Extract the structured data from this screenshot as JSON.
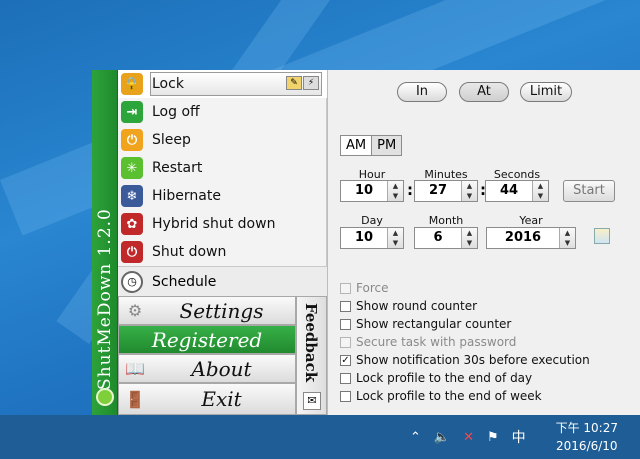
{
  "app": {
    "title": "ShutMeDown 1.2.0",
    "menu": [
      {
        "label": "Lock",
        "icon": "lock-icon",
        "color": "#e8a21b"
      },
      {
        "label": "Log off",
        "icon": "logoff-icon",
        "color": "#2ca53a"
      },
      {
        "label": "Sleep",
        "icon": "sleep-icon",
        "color": "#f0a31c"
      },
      {
        "label": "Restart",
        "icon": "restart-icon",
        "color": "#5bc02f"
      },
      {
        "label": "Hibernate",
        "icon": "hibernate-icon",
        "color": "#3a5a9a"
      },
      {
        "label": "Hybrid shut down",
        "icon": "hybrid-shutdown-icon",
        "color": "#c0282a"
      },
      {
        "label": "Shut down",
        "icon": "shutdown-icon",
        "color": "#c0282a"
      }
    ],
    "schedule_label": "Schedule",
    "buttons": {
      "settings": "Settings",
      "registered": "Registered",
      "about": "About",
      "exit": "Exit"
    },
    "feedback": "Feedback"
  },
  "panel": {
    "modes": {
      "in": "In",
      "at": "At",
      "limit": "Limit"
    },
    "am": "AM",
    "pm": "PM",
    "labels": {
      "hour": "Hour",
      "minutes": "Minutes",
      "seconds": "Seconds",
      "day": "Day",
      "month": "Month",
      "year": "Year"
    },
    "values": {
      "hour": "10",
      "minutes": "27",
      "seconds": "44",
      "day": "10",
      "month": "6",
      "year": "2016"
    },
    "start": "Start",
    "options": [
      {
        "label": "Force",
        "checked": false,
        "disabled": true
      },
      {
        "label": "Show round counter",
        "checked": false,
        "disabled": false
      },
      {
        "label": "Show rectangular counter",
        "checked": false,
        "disabled": false
      },
      {
        "label": "Secure task with password",
        "checked": false,
        "disabled": true
      },
      {
        "label": "Show notification 30s before execution",
        "checked": true,
        "disabled": false
      },
      {
        "label": "Lock profile to the end of day",
        "checked": false,
        "disabled": false
      },
      {
        "label": "Lock profile to the end of week",
        "checked": false,
        "disabled": false
      }
    ]
  },
  "taskbar": {
    "ime": "中",
    "time": "下午 10:27",
    "date": "2016/6/10"
  }
}
